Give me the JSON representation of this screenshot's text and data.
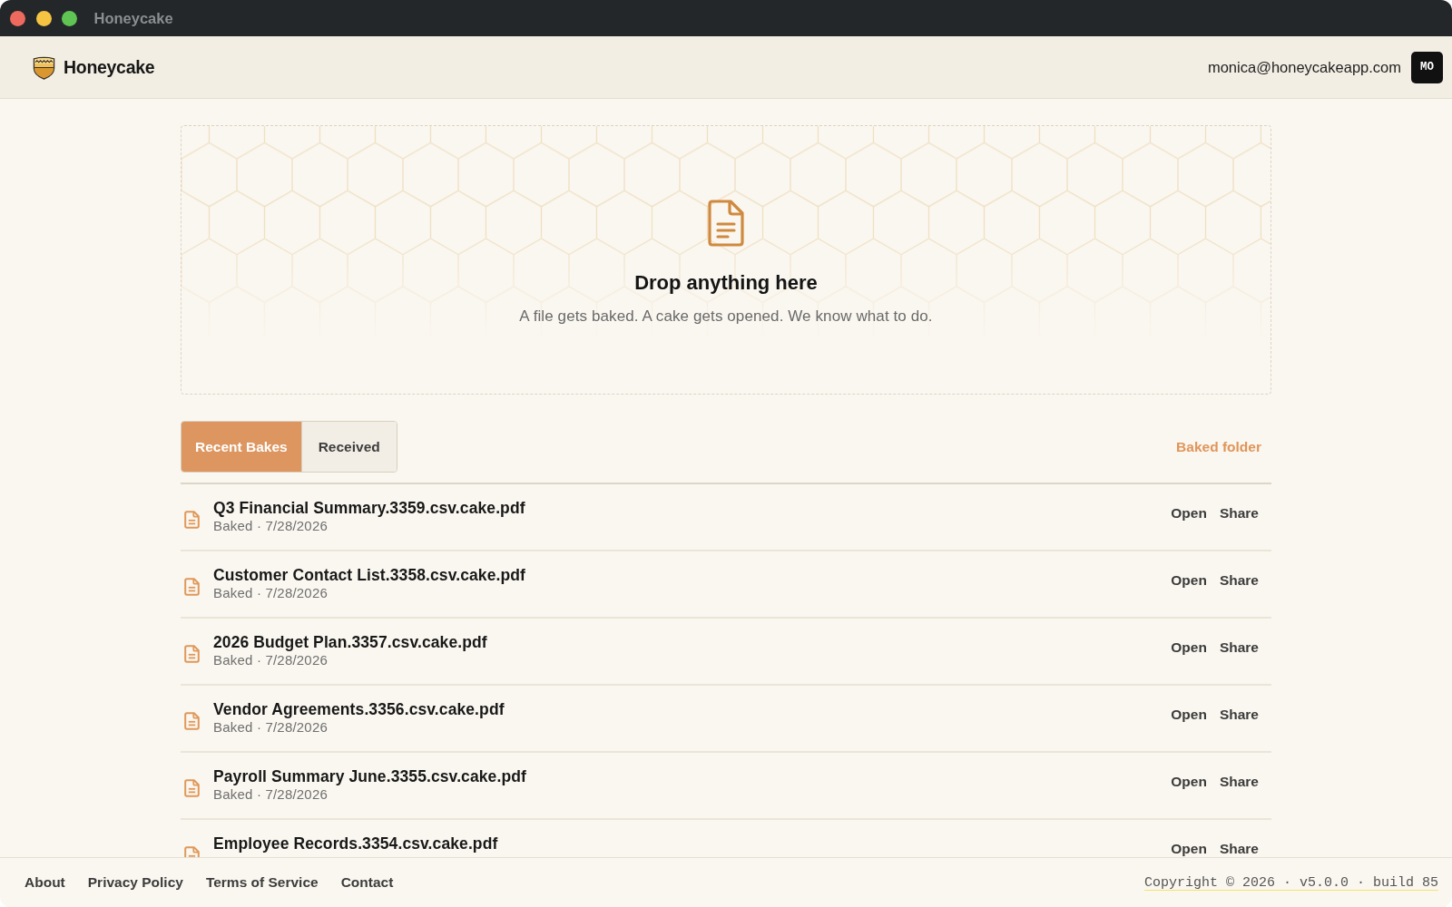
{
  "window": {
    "title": "Honeycake"
  },
  "header": {
    "brand": "Honeycake",
    "email": "monica@honeycakeapp.com",
    "avatar_initials": "MO"
  },
  "drop_zone": {
    "title": "Drop anything here",
    "subtitle": "A file gets baked. A cake gets opened. We know what to do."
  },
  "tabs": [
    {
      "label": "Recent Bakes",
      "selected": true
    },
    {
      "label": "Received",
      "selected": false
    }
  ],
  "folder_link": "Baked folder",
  "files": [
    {
      "name": "Q3 Financial Summary.3359.csv.cake.pdf",
      "meta": "Baked · 7/28/2026",
      "actions": [
        "Open",
        "Share"
      ]
    },
    {
      "name": "Customer Contact List.3358.csv.cake.pdf",
      "meta": "Baked · 7/28/2026",
      "actions": [
        "Open",
        "Share"
      ]
    },
    {
      "name": "2026 Budget Plan.3357.csv.cake.pdf",
      "meta": "Baked · 7/28/2026",
      "actions": [
        "Open",
        "Share"
      ]
    },
    {
      "name": "Vendor Agreements.3356.csv.cake.pdf",
      "meta": "Baked · 7/28/2026",
      "actions": [
        "Open",
        "Share"
      ]
    },
    {
      "name": "Payroll Summary June.3355.csv.cake.pdf",
      "meta": "Baked · 7/28/2026",
      "actions": [
        "Open",
        "Share"
      ]
    },
    {
      "name": "Employee Records.3354.csv.cake.pdf",
      "actions": [
        "Open",
        "Share"
      ]
    }
  ],
  "footer": {
    "links": [
      "About",
      "Privacy Policy",
      "Terms of Service",
      "Contact"
    ],
    "copyright": "Copyright © 2026 · v5.0.0 · build 85"
  }
}
